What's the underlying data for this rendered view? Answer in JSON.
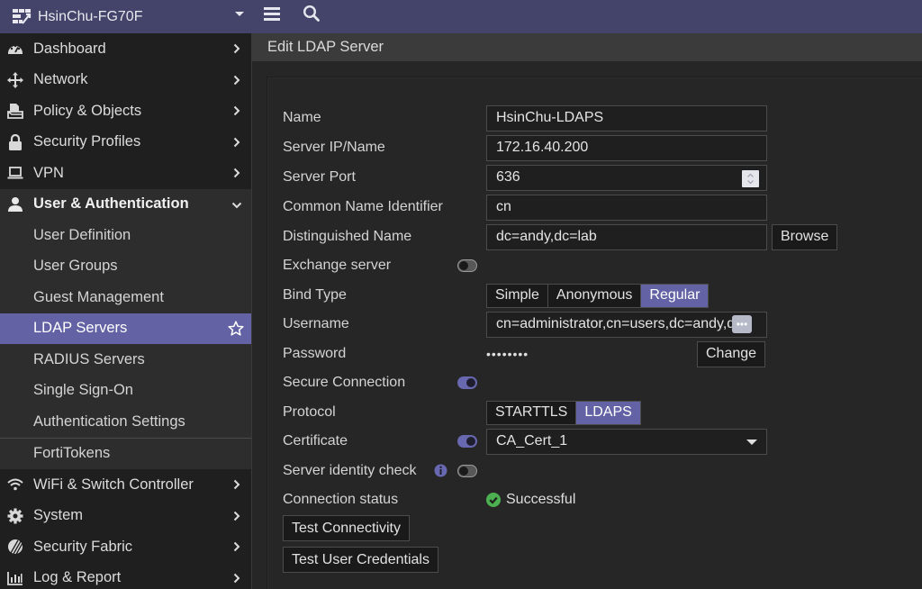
{
  "topbar": {
    "device_name": "HsinChu-FG70F",
    "icons": {
      "logo": "fortigate-logo-icon",
      "caret": "caret-down-icon",
      "menu": "hamburger-menu-icon",
      "search": "search-icon"
    }
  },
  "sidebar": {
    "items_top": [
      {
        "label": "Dashboard",
        "icon": "dashboard-gauge-icon"
      },
      {
        "label": "Network",
        "icon": "network-arrows-icon"
      },
      {
        "label": "Policy & Objects",
        "icon": "policy-document-icon"
      },
      {
        "label": "Security Profiles",
        "icon": "lock-icon"
      },
      {
        "label": "VPN",
        "icon": "laptop-icon"
      }
    ],
    "expanded": {
      "label": "User & Authentication",
      "icon": "user-icon"
    },
    "sub_items": [
      {
        "label": "User Definition"
      },
      {
        "label": "User Groups"
      },
      {
        "label": "Guest Management"
      },
      {
        "label": "LDAP Servers",
        "active": true
      },
      {
        "label": "RADIUS Servers"
      },
      {
        "label": "Single Sign-On"
      },
      {
        "label": "Authentication Settings"
      },
      {
        "label": "FortiTokens"
      }
    ],
    "items_bottom": [
      {
        "label": "WiFi & Switch Controller",
        "icon": "wifi-icon"
      },
      {
        "label": "System",
        "icon": "gear-icon"
      },
      {
        "label": "Security Fabric",
        "icon": "security-fabric-icon"
      },
      {
        "label": "Log & Report",
        "icon": "bar-chart-icon"
      }
    ]
  },
  "main": {
    "page_title": "Edit LDAP Server",
    "form": {
      "name": {
        "label": "Name",
        "value": "HsinChu-LDAPS"
      },
      "server_ip": {
        "label": "Server IP/Name",
        "value": "172.16.40.200"
      },
      "server_port": {
        "label": "Server Port",
        "value": "636"
      },
      "cn_identifier": {
        "label": "Common Name Identifier",
        "value": "cn"
      },
      "distinguished_name": {
        "label": "Distinguished Name",
        "value": "dc=andy,dc=lab",
        "button": "Browse"
      },
      "exchange_server": {
        "label": "Exchange server",
        "enabled": false
      },
      "bind_type": {
        "label": "Bind Type",
        "options": [
          "Simple",
          "Anonymous",
          "Regular"
        ],
        "selected": "Regular"
      },
      "username": {
        "label": "Username",
        "value": "cn=administrator,cn=users,dc=andy,dc=",
        "more_button": "•••"
      },
      "password": {
        "label": "Password",
        "value": "••••••••",
        "button": "Change"
      },
      "secure_connection": {
        "label": "Secure Connection",
        "enabled": true
      },
      "protocol": {
        "label": "Protocol",
        "options": [
          "STARTTLS",
          "LDAPS"
        ],
        "selected": "LDAPS"
      },
      "certificate": {
        "label": "Certificate",
        "enabled": true,
        "value": "CA_Cert_1"
      },
      "server_identity_check": {
        "label": "Server identity check",
        "enabled": false,
        "info_icon": "info-icon"
      },
      "connection_status": {
        "label": "Connection status",
        "value": "Successful",
        "status_color": "#4caf50"
      },
      "test_connectivity": "Test Connectivity",
      "test_user_credentials": "Test User Credentials"
    }
  },
  "colors": {
    "topbar_bg": "#44446a",
    "accent": "#6262a4",
    "sidebar_bg": "#1f1f1f",
    "main_bg": "#262626",
    "success": "#4caf50"
  }
}
